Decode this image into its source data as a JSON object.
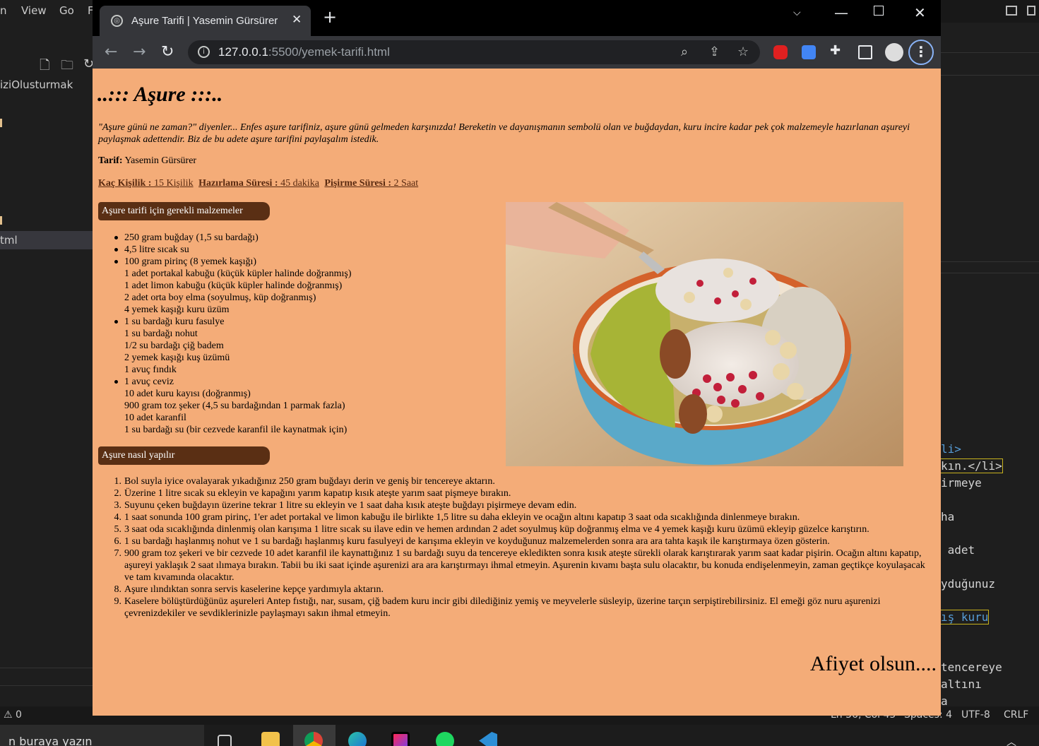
{
  "vscode": {
    "menu": [
      "n",
      "View",
      "Go",
      "F"
    ],
    "explorer_items": [
      "iziOlusturmak",
      "tml"
    ],
    "code_lines": [
      {
        "text": "li>",
        "kind": "tag"
      },
      {
        "text": "kın.</li>",
        "kind": "tag"
      },
      {
        "text": "irmeye",
        "kind": "text"
      },
      {
        "text": "ha",
        "kind": "text"
      },
      {
        "text": " adet",
        "kind": "text"
      },
      {
        "text": "yduğunuz",
        "kind": "text"
      },
      {
        "text": "ış kuru",
        "kind": "text"
      },
      {
        "text": "tencereye",
        "kind": "text"
      },
      {
        "text": "altını",
        "kind": "text"
      },
      {
        "text": "a",
        "kind": "text"
      }
    ],
    "status": {
      "problems": "⚠ 0",
      "position": "Ln 56, Col 45",
      "spaces": "Spaces: 4",
      "encoding": "UTF-8",
      "eol": "CRLF"
    }
  },
  "taskbar": {
    "search_placeholder": "n buraya yazın"
  },
  "browser": {
    "tab_title": "Aşure Tarifi | Yasemin Gürsürer",
    "url_host": "127.0.0.1",
    "url_path": ":5500/yemek-tarifi.html"
  },
  "page": {
    "title": "..::: Aşure :::..",
    "intro": "\"Aşure günü ne zaman?\" diyenler... Enfes aşure tarifiniz, aşure günü gelmeden karşınızda! Bereketin ve dayanışmanın sembolü olan ve buğdaydan, kuru incire kadar pek çok malzemeyle hazırlanan aşureyi paylaşmak adettendir. Biz de bu adete aşure tarifini paylaşalım istedik.",
    "author_label": "Tarif:",
    "author_name": " Yasemin Gürsürer",
    "meta": [
      {
        "label": "Kaç Kişilik : ",
        "value": "15 Kişilik"
      },
      {
        "label": "Hazırlama Süresi : ",
        "value": "45 dakika"
      },
      {
        "label": "Pişirme Süresi : ",
        "value": "2 Saat"
      }
    ],
    "ingredients_heading": "Aşure tarifi için gerekli malzemeler",
    "ingredients": [
      {
        "text": "250 gram buğday (1,5 su bardağı)",
        "bullet": true
      },
      {
        "text": "4,5 litre sıcak su",
        "bullet": true
      },
      {
        "text": "100 gram pirinç (8 yemek kaşığı)",
        "bullet": true
      },
      {
        "text": "1 adet portakal kabuğu (küçük küpler halinde doğranmış)",
        "bullet": false
      },
      {
        "text": "1 adet limon kabuğu (küçük küpler halinde doğranmış)",
        "bullet": false
      },
      {
        "text": "2 adet orta boy elma (soyulmuş, küp doğranmış)",
        "bullet": false
      },
      {
        "text": "4 yemek kaşığı kuru üzüm",
        "bullet": false
      },
      {
        "text": "1 su bardağı kuru fasulye",
        "bullet": true
      },
      {
        "text": "1 su bardağı nohut",
        "bullet": false
      },
      {
        "text": "1/2 su bardağı çiğ badem",
        "bullet": false
      },
      {
        "text": "2 yemek kaşığı kuş üzümü",
        "bullet": false
      },
      {
        "text": "1 avuç fındık",
        "bullet": false
      },
      {
        "text": "1 avuç ceviz",
        "bullet": true
      },
      {
        "text": "10 adet kuru kayısı (doğranmış)",
        "bullet": false
      },
      {
        "text": "900 gram toz şeker (4,5 su bardağından 1 parmak fazla)",
        "bullet": false
      },
      {
        "text": "10 adet karanfil",
        "bullet": false
      },
      {
        "text": "1 su bardağı su (bir cezvede karanfil ile kaynatmak için)",
        "bullet": false
      }
    ],
    "steps_heading": "Aşure nasıl yapılır",
    "steps": [
      {
        "n": "1.",
        "text": "Bol suyla iyice ovalayarak yıkadığınız 250 gram buğdayı derin ve geniş bir tencereye aktarın."
      },
      {
        "n": "2.",
        "text": "Üzerine 1 litre sıcak su ekleyin ve kapağını yarım kapatıp kısık ateşte yarım saat pişmeye bırakın."
      },
      {
        "n": "3.",
        "text": "Suyunu çeken buğdayın üzerine tekrar 1 litre su ekleyin ve 1 saat daha kısık ateşte buğdayı pişirmeye devam edin."
      },
      {
        "n": "4.",
        "text": "1 saat sonunda 100 gram pirinç, 1'er adet portakal ve limon kabuğu ile birlikte 1,5 litre su daha ekleyin ve ocağın altını kapatıp 3 saat oda sıcaklığında dinlenmeye bırakın."
      },
      {
        "n": "5.",
        "text": "3 saat oda sıcaklığında dinlenmiş olan karışıma 1 litre sıcak su ilave edin ve hemen ardından 2 adet soyulmuş küp doğranmış elma ve 4 yemek kaşığı kuru üzümü ekleyip güzelce karıştırın."
      },
      {
        "n": "6.",
        "text": "1 su bardağı haşlanmış nohut ve 1 su bardağı haşlanmış kuru fasulyeyi de karışıma ekleyin ve koyduğunuz malzemelerden sonra ara ara tahta kaşık ile karıştırmaya özen gösterin."
      },
      {
        "n": "7.",
        "text": "900 gram toz şekeri ve bir cezvede 10 adet karanfil ile kaynattığınız 1 su bardağı suyu da tencereye ekledikten sonra kısık ateşte sürekli olarak karıştırarak yarım saat kadar pişirin. Ocağın altını kapatıp, aşureyi yaklaşık 2 saat ılımaya bırakın. Tabii bu iki saat içinde aşurenizi ara ara karıştırmayı ihmal etmeyin. Aşurenin kıvamı başta sulu olacaktır, bu konuda endişelenmeyin, zaman geçtikçe koyulaşacak ve tam kıvamında olacaktır."
      },
      {
        "n": "8.",
        "text": "Aşure ılındıktan sonra servis kaselerine kepçe yardımıyla aktarın."
      },
      {
        "n": "9.",
        "text": "Kaselere bölüştürdüğünüz aşureleri Antep fıstığı, nar, susam, çiğ badem kuru incir gibi dilediğiniz yemiş ve meyvelerle süsleyip, üzerine tarçın serpiştirebilirsiniz. El emeği göz nuru aşurenizi çevrenizdekiler ve sevdiklerinizle paylaşmayı sakın ihmal etmeyin."
      }
    ],
    "closing": "Afiyet olsun...."
  },
  "colors": {
    "page_bg": "#f4ac78",
    "section_bg": "#5a2f14",
    "link": "#5a2a10",
    "bowl_blue": "#5aa9c9",
    "bowl_rim": "#d4622b"
  }
}
